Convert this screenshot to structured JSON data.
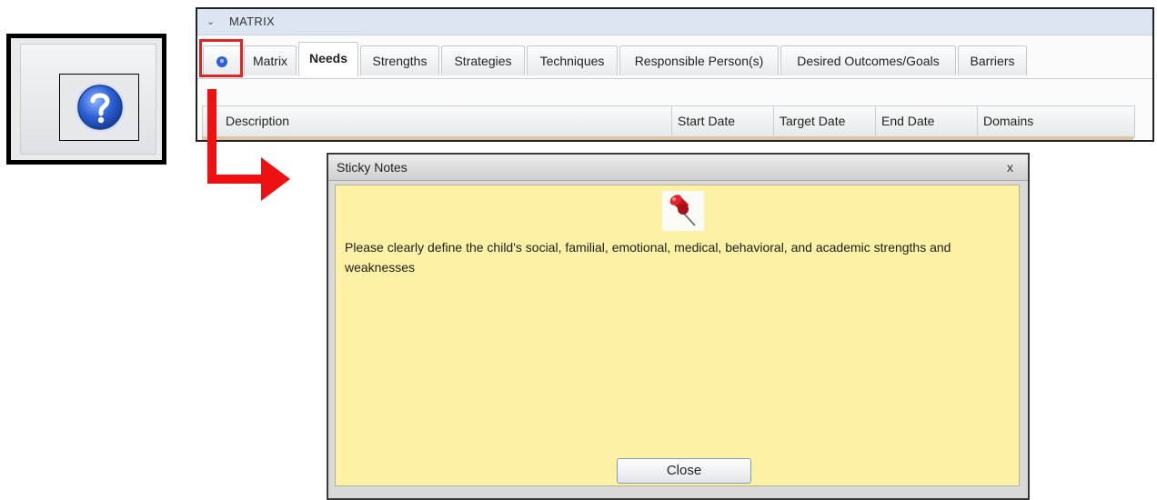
{
  "zoom": {
    "icon": "help-question-icon"
  },
  "panel": {
    "title": "MATRIX",
    "collapse_icon": "chevron-down-icon",
    "tabs": [
      {
        "label": "",
        "icon": "help-question-icon"
      },
      {
        "label": "Matrix"
      },
      {
        "label": "Needs",
        "active": true
      },
      {
        "label": "Strengths"
      },
      {
        "label": "Strategies"
      },
      {
        "label": "Techniques"
      },
      {
        "label": "Responsible Person(s)"
      },
      {
        "label": "Desired Outcomes/Goals"
      },
      {
        "label": "Barriers"
      }
    ],
    "columns": [
      "Description",
      "Start Date",
      "Target Date",
      "End Date",
      "Domains"
    ]
  },
  "dialog": {
    "title": "Sticky Notes",
    "close_x": "x",
    "icon": "pushpin-icon",
    "text": "Please clearly define the child's social, familial, emotional, medical, behavioral, and academic strengths and weaknesses",
    "close_label": "Close"
  },
  "colors": {
    "highlight": "#e32222",
    "arrow": "#ee1111",
    "note_background": "#fdf1a5",
    "header_background": "#dbe6f2"
  }
}
